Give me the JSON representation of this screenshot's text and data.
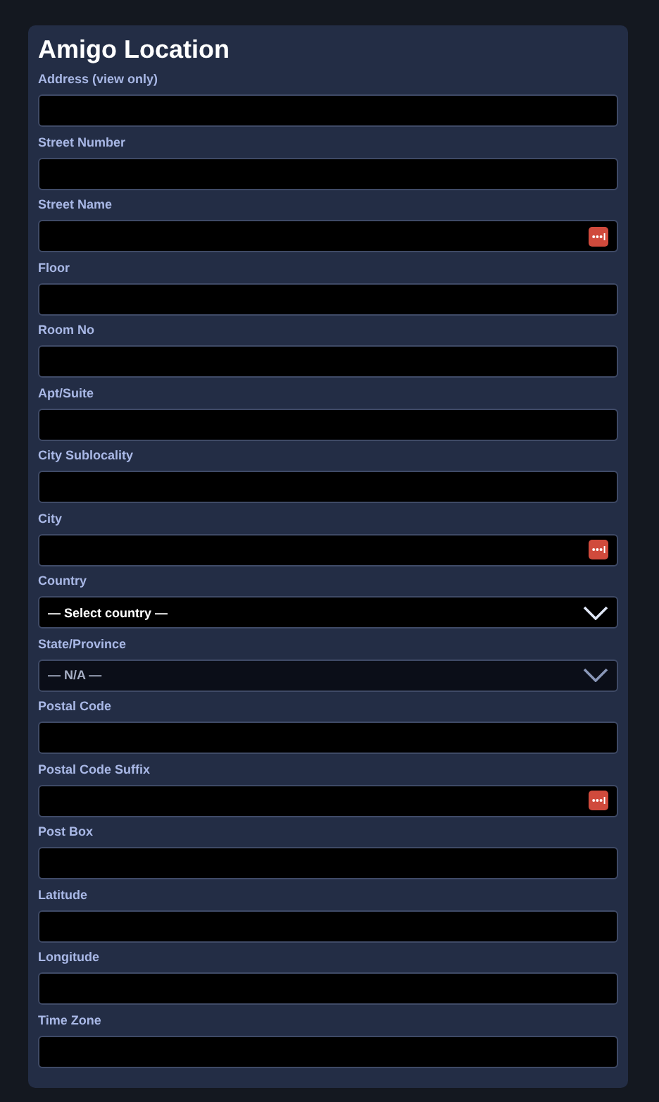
{
  "title": "Amigo Location",
  "fields": [
    {
      "kind": "text",
      "label": "Address (view only)",
      "autofill": false
    },
    {
      "kind": "text",
      "label": "Street Number",
      "autofill": false
    },
    {
      "kind": "text",
      "label": "Street Name",
      "autofill": true
    },
    {
      "kind": "text",
      "label": "Floor",
      "autofill": false
    },
    {
      "kind": "text",
      "label": "Room No",
      "autofill": false
    },
    {
      "kind": "text",
      "label": "Apt/Suite",
      "autofill": false
    },
    {
      "kind": "text",
      "label": "City Sublocality",
      "autofill": false
    },
    {
      "kind": "text",
      "label": "City",
      "autofill": true
    },
    {
      "kind": "select",
      "label": "Country",
      "value": "— Select country —",
      "disabled": false
    },
    {
      "kind": "select",
      "label": "State/Province",
      "value": "— N/A —",
      "disabled": true
    },
    {
      "kind": "text",
      "label": "Postal Code",
      "autofill": false
    },
    {
      "kind": "text",
      "label": "Postal Code Suffix",
      "autofill": true
    },
    {
      "kind": "text",
      "label": "Post Box",
      "autofill": false
    },
    {
      "kind": "text",
      "label": "Latitude",
      "autofill": false
    },
    {
      "kind": "text",
      "label": "Longitude",
      "autofill": false
    },
    {
      "kind": "text",
      "label": "Time Zone",
      "autofill": false
    }
  ]
}
